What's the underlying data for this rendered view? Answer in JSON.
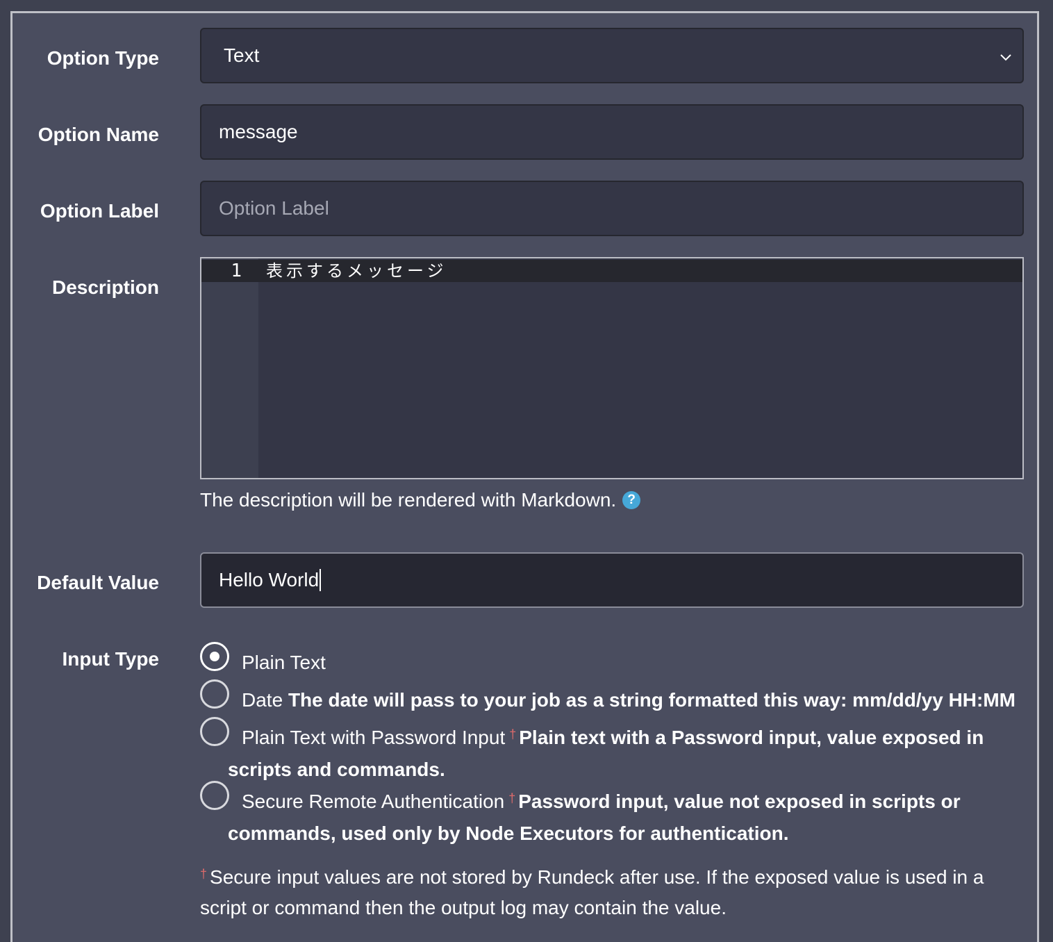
{
  "labels": {
    "option_type": "Option Type",
    "option_name": "Option Name",
    "option_label": "Option Label",
    "description": "Description",
    "default_value": "Default Value",
    "input_type": "Input Type"
  },
  "option_type": {
    "selected": "Text",
    "icon": "chevron-down-icon"
  },
  "option_name": {
    "value": "message"
  },
  "option_label": {
    "placeholder": "Option Label"
  },
  "description_editor": {
    "line_number": "1",
    "text": "表示するメッセージ",
    "help_text": "The description will be rendered with Markdown.",
    "help_icon": "?"
  },
  "default_value": {
    "value": "Hello World"
  },
  "input_type": {
    "selected": "Plain Text",
    "options": [
      {
        "label": "Plain Text",
        "desc": ""
      },
      {
        "label": "Date",
        "desc": "The date will pass to your job as a string formatted this way: mm/dd/yy HH:MM"
      },
      {
        "label": "Plain Text with Password Input",
        "dagger": "†",
        "desc_line1": "Plain text with a Password input, value exposed in",
        "desc_line2": "scripts and commands."
      },
      {
        "label": "Secure Remote Authentication",
        "dagger": "†",
        "desc_line1": "Password input, value not exposed in scripts or",
        "desc_line2": "commands, used only by Node Executors for authentication."
      }
    ],
    "footnote_dagger": "†",
    "footnote_text": "Secure input values are not stored by Rundeck after use. If the exposed value is used in a script or command then the output log may contain the value."
  },
  "colors": {
    "panel_bg": "#4a4d5f",
    "field_bg": "#343646",
    "focused_field_bg": "#262732",
    "help_icon": "#46a8d8",
    "dagger": "#e06b6b"
  }
}
